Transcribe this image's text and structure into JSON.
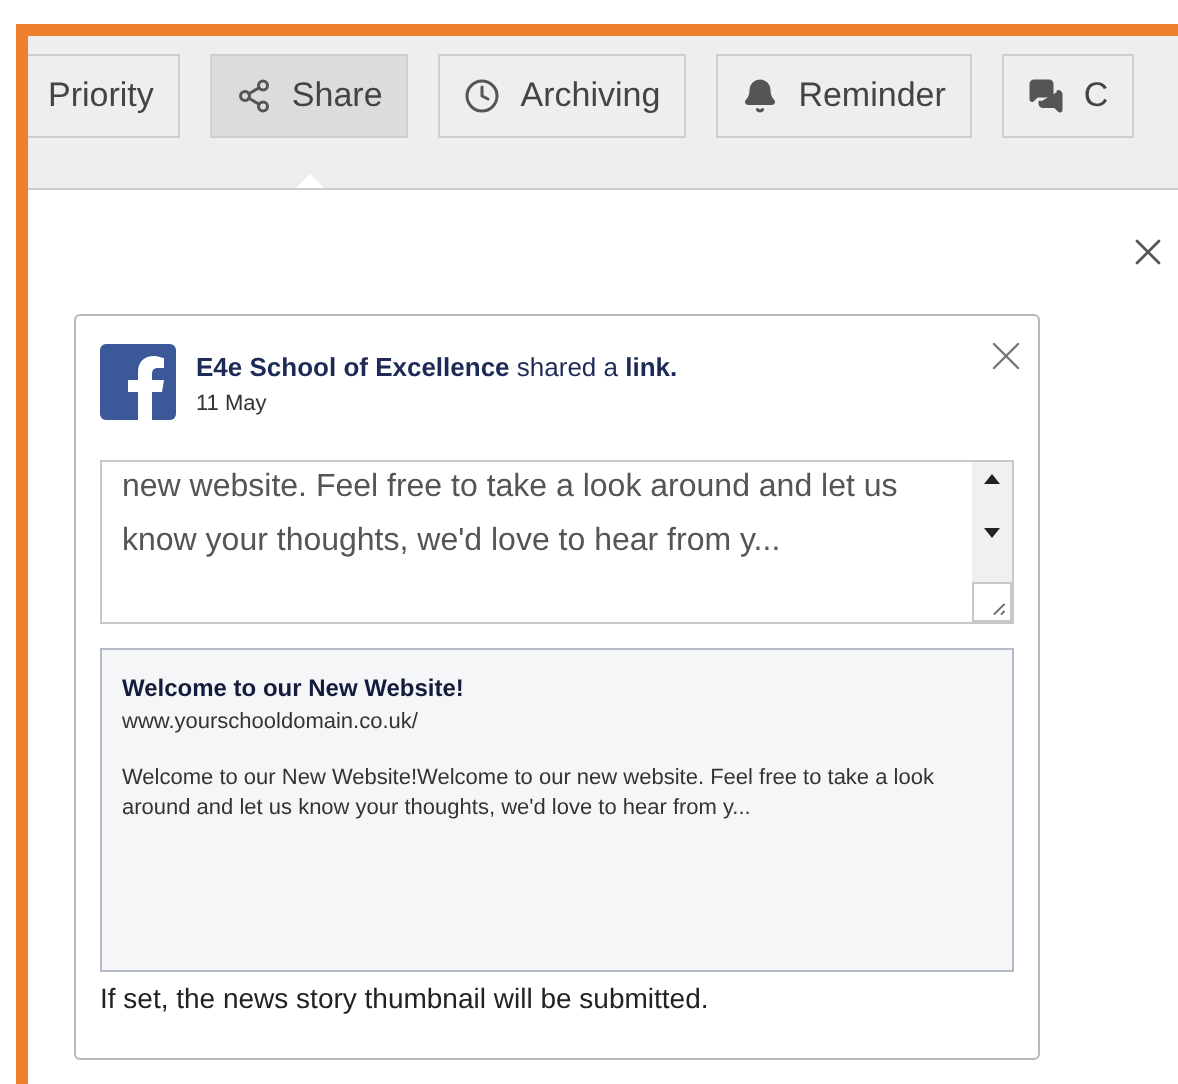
{
  "toolbar": {
    "tabs": [
      {
        "label": "Priority",
        "kind": "plain",
        "selected": false
      },
      {
        "label": "Share",
        "kind": "share",
        "selected": true
      },
      {
        "label": "Archiving",
        "kind": "clock",
        "selected": false
      },
      {
        "label": "Reminder",
        "kind": "bell",
        "selected": false
      },
      {
        "label": "C",
        "kind": "comments",
        "selected": false
      }
    ]
  },
  "post": {
    "header": "**E4e School of Excellence** shared a **link.**",
    "date": "11 May",
    "message": "new website.  Feel free to take a look around and let us know your thoughts, we'd love to hear from y...",
    "preview": {
      "title": "Welcome to our New Website!",
      "url": "www.yourschooldomain.co.uk/",
      "description": "Welcome to our New Website!Welcome to our new website.  Feel free to take a look around and let us know your thoughts, we'd love to hear from y..."
    },
    "caption": "If set, the news story thumbnail will be submitted."
  }
}
